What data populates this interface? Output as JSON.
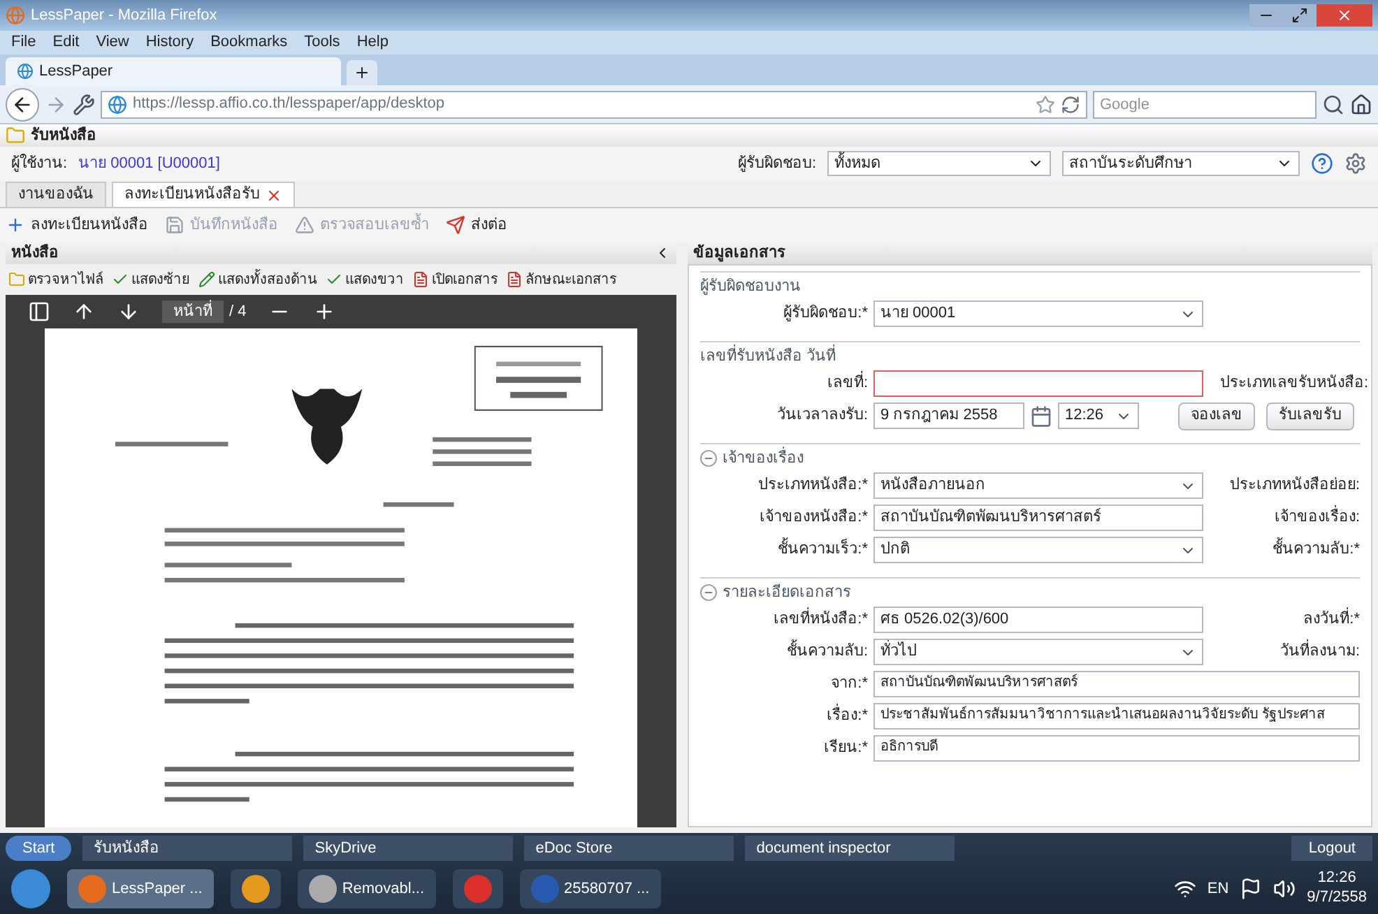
{
  "window": {
    "title": "LessPaper - Mozilla Firefox"
  },
  "menu": [
    "File",
    "Edit",
    "View",
    "History",
    "Bookmarks",
    "Tools",
    "Help"
  ],
  "browser_tabs": [
    {
      "label": "LessPaper",
      "selected": true
    }
  ],
  "address_bar": {
    "url": "https://lessp.affio.co.th/lesspaper/app/desktop"
  },
  "search_bar": {
    "placeholder": "Google"
  },
  "app": {
    "title": "รับหนังสือ",
    "user_label": "ผู้ใช้งาน:",
    "user": "นาย 00001 [U00001]",
    "unit_label": "ผู้รับผิดชอบ:",
    "unit_value": "ทั้งหมด",
    "org_value": "สถาบันระดับศึกษา"
  },
  "app_tabs": [
    {
      "label": "งานของฉัน",
      "selected": false,
      "closable": false
    },
    {
      "label": "ลงทะเบียนหนังสือรับ",
      "selected": true,
      "closable": true
    }
  ],
  "toolbar": [
    {
      "label": "ลงทะเบียนหนังสือ",
      "kind": "add",
      "disabled": false
    },
    {
      "label": "บันทึกหนังสือ",
      "kind": "save",
      "disabled": true
    },
    {
      "label": "ตรวจสอบเลขซ้ำ",
      "kind": "warn",
      "disabled": true
    },
    {
      "label": "ส่งต่อ",
      "kind": "send",
      "disabled": false
    }
  ],
  "left_panel": {
    "title": "หนังสือ",
    "toolbar": [
      {
        "label": "ตรวจหาไฟล์",
        "kind": "folder"
      },
      {
        "label": "แสดงซ้าย",
        "kind": "check"
      },
      {
        "label": "แสดงทั้งสองด้าน",
        "kind": "pen"
      },
      {
        "label": "แสดงขวา",
        "kind": "check"
      },
      {
        "label": "เปิดเอกสาร",
        "kind": "pdf"
      },
      {
        "label": "ลักษณะเอกสาร",
        "kind": "pdf"
      }
    ],
    "viewer": {
      "page_label": "หน้าที่",
      "page_count": "/ 4"
    }
  },
  "right_panel": {
    "title": "ข้อมูลเอกสาร",
    "sections": [
      {
        "title": "ผู้รับผิดชอบงาน",
        "collapsible": false,
        "rows": [
          {
            "label": "ผู้รับผิดชอบ:*",
            "kind": "select",
            "value": "นาย 00001"
          }
        ]
      },
      {
        "title": "เลขที่รับหนังสือ วันที่",
        "collapsible": false,
        "rows": [
          {
            "label": "เลขที่:",
            "kind": "text",
            "invalid": true,
            "side_label": "ประเภทเลขรับหนังสือ:"
          },
          {
            "label": "วันเวลาลงรับ:",
            "kind": "datetime",
            "value": "9 กรกฎาคม 2558",
            "time": "12:26",
            "buttons": [
              "จองเลข",
              "รับเลขรับ"
            ]
          }
        ]
      },
      {
        "title": "เจ้าของเรื่อง",
        "collapsible": true,
        "rows": [
          {
            "label": "ประเภทหนังสือ:*",
            "kind": "select",
            "value": "หนังสือภายนอก",
            "side_label": "ประเภทหนังสือย่อย:"
          },
          {
            "label": "เจ้าของหนังสือ:*",
            "kind": "text",
            "value": "สถาบันบัณฑิตพัฒนบริหารศาสตร์",
            "side_label": "เจ้าของเรื่อง:"
          },
          {
            "label": "ชั้นความเร็ว:*",
            "kind": "select",
            "value": "ปกติ",
            "side_label": "ชั้นความลับ:*"
          }
        ]
      },
      {
        "title": "รายละเอียดเอกสาร",
        "collapsible": true,
        "rows": [
          {
            "label": "เลขที่หนังสือ:*",
            "kind": "text",
            "value": "ศธ 0526.02(3)/600",
            "side_label": "ลงวันที่:*"
          },
          {
            "label": "ชั้นความลับ:",
            "kind": "select",
            "value": "ทั่วไป",
            "side_label": "วันที่ลงนาม:"
          },
          {
            "label": "จาก:*",
            "kind": "wide",
            "value": "สถาบันบัณฑิตพัฒนบริหารศาสตร์"
          },
          {
            "label": "เรื่อง:*",
            "kind": "wide",
            "value": "ประชาสัมพันธ์การสัมมนาวิชาการและนำเสนอผลงานวิจัยระดับ รัฐประศาส"
          },
          {
            "label": "เรียน:*",
            "kind": "wide",
            "value": "อธิการบดี"
          }
        ]
      }
    ]
  },
  "taskbar": {
    "start": "Start",
    "tasks": [
      "รับหนังสือ",
      "SkyDrive",
      "eDoc Store",
      "document inspector"
    ],
    "logout": "Logout",
    "apps": [
      {
        "kind": "firefox",
        "label": "LessPaper ...",
        "selected": true
      },
      {
        "kind": "media",
        "selected": false
      },
      {
        "kind": "drive",
        "label": "Removabl...",
        "selected": false
      },
      {
        "kind": "chrome",
        "selected": false
      },
      {
        "kind": "word",
        "label": "25580707 ...",
        "selected": false
      }
    ],
    "language": "EN",
    "time": "12:26",
    "date": "9/7/2558"
  }
}
